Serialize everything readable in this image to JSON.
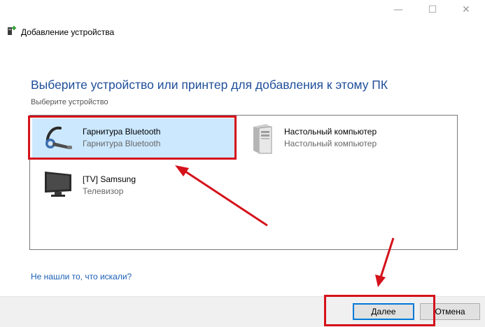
{
  "window": {
    "title": "Добавление устройства",
    "controls": {
      "minimize": "—",
      "maximize": "☐",
      "close": "✕"
    }
  },
  "main": {
    "heading": "Выберите устройство или принтер для добавления к этому ПК",
    "subheading": "Выберите устройство",
    "devices": [
      {
        "name": "Гарнитура Bluetooth",
        "type": "Гарнитура Bluetooth",
        "icon": "headset-icon",
        "selected": true
      },
      {
        "name": "Настольный компьютер",
        "type": "Настольный компьютер",
        "icon": "desktop-tower-icon",
        "selected": false
      },
      {
        "name": "[TV] Samsung",
        "type": "Телевизор",
        "icon": "tv-icon",
        "selected": false
      }
    ],
    "help_link": "Не нашли то, что искали?"
  },
  "footer": {
    "next_label": "Далее",
    "cancel_label": "Отмена"
  },
  "colors": {
    "heading": "#1f4e9a",
    "selection": "#cce8ff",
    "annotation": "#d5121c",
    "link": "#1a5fb4"
  }
}
